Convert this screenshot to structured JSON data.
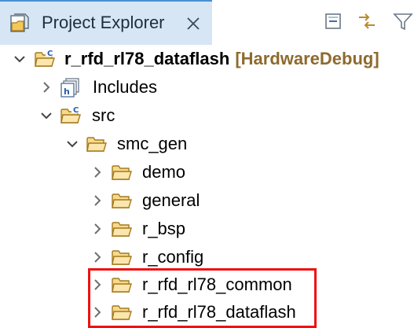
{
  "view": {
    "title": "Project Explorer",
    "icon": "project-explorer-icon",
    "close_icon": "close-icon",
    "toolbar": [
      {
        "name": "collapse-all-button",
        "icon": "collapse-all-icon"
      },
      {
        "name": "link-with-editor-button",
        "icon": "link-with-editor-icon"
      },
      {
        "name": "filter-button",
        "icon": "filter-icon"
      }
    ]
  },
  "tree": {
    "project": {
      "name": "r_rfd_rl78_dataflash",
      "decoration": "[HardwareDebug]",
      "expanded": true,
      "icon": "c-project-icon"
    },
    "items": [
      {
        "label": "Includes",
        "expanded": false,
        "icon": "includes-icon"
      },
      {
        "label": "src",
        "expanded": true,
        "icon": "source-folder-icon"
      },
      {
        "label": "smc_gen",
        "expanded": true,
        "icon": "folder-icon"
      },
      {
        "label": "demo",
        "expanded": false,
        "icon": "folder-icon"
      },
      {
        "label": "general",
        "expanded": false,
        "icon": "folder-icon"
      },
      {
        "label": "r_bsp",
        "expanded": false,
        "icon": "folder-icon"
      },
      {
        "label": "r_config",
        "expanded": false,
        "icon": "folder-icon"
      },
      {
        "label": "r_rfd_rl78_common",
        "expanded": false,
        "icon": "folder-icon"
      },
      {
        "label": "r_rfd_rl78_dataflash",
        "expanded": false,
        "icon": "folder-icon"
      }
    ]
  },
  "colors": {
    "tab_background": "#d7e6f4",
    "tab_accent": "#4a8fd4",
    "folder": "#e8b85c",
    "decoration": "#8e6a2e",
    "highlight": "#ee1111"
  }
}
